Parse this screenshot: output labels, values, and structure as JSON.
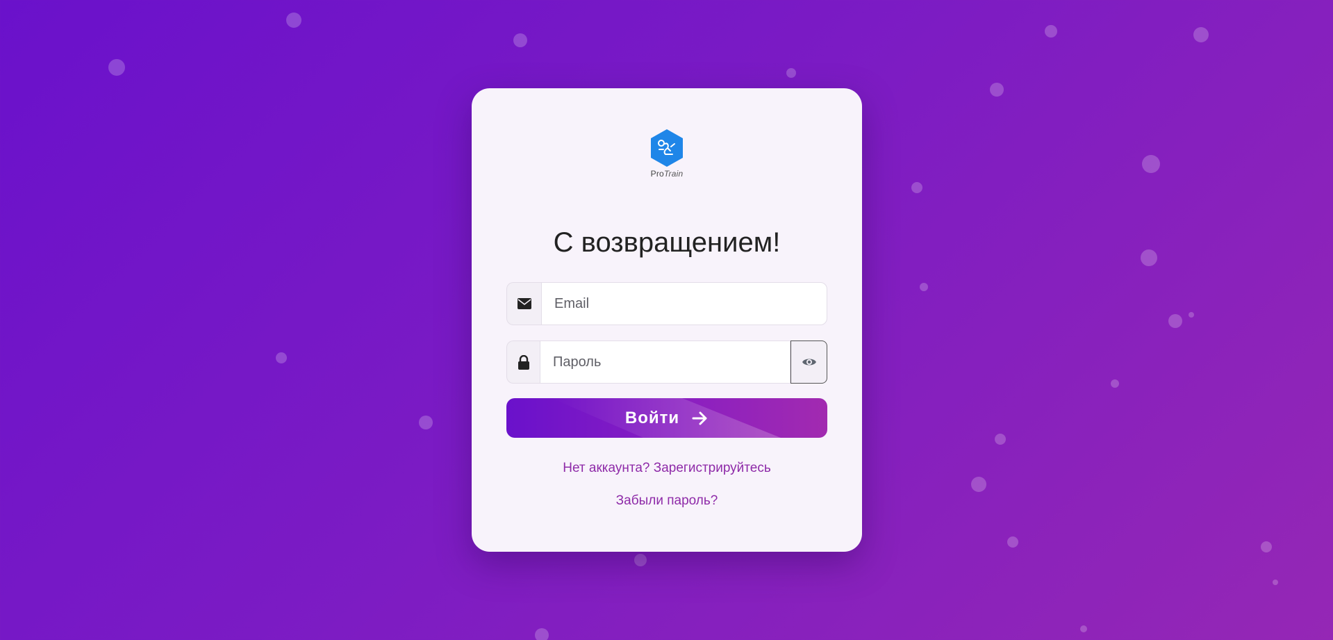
{
  "brand": {
    "name_part1": "Pro",
    "name_part2": "Train",
    "logo_color": "#1f86e8"
  },
  "login": {
    "title": "С возвращением!",
    "email": {
      "placeholder": "Email",
      "value": ""
    },
    "password": {
      "placeholder": "Пароль",
      "value": ""
    },
    "submit_label": "Войти",
    "register_link": "Нет аккаунта? Зарегистрируйтесь",
    "forgot_link": "Забыли пароль?"
  },
  "icons": {
    "email": "envelope-icon",
    "password": "lock-icon",
    "toggle": "eye-icon",
    "submit": "arrow-right-icon",
    "logo": "runner-hexagon-icon"
  },
  "colors": {
    "background_start": "#6a11cb",
    "background_end": "#9527b5",
    "card": "#f8f3fb",
    "link": "#8e2aa8",
    "title": "#222222"
  }
}
